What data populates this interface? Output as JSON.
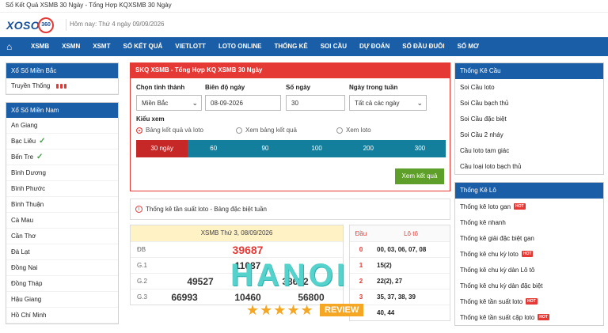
{
  "topbar": "Sổ Kết Quả XSMB 30 Ngày - Tổng Hợp KQXSMB 30 Ngày",
  "logo": {
    "brand": "XOSO",
    "number": "360"
  },
  "date_text": "Hôm nay: Thứ 4 ngày 09/09/2026",
  "nav": [
    "XSMB",
    "XSMN",
    "XSMT",
    "SỔ KẾT QUẢ",
    "VIETLOTT",
    "LOTO ONLINE",
    "THỐNG KÊ",
    "SOI CẦU",
    "DỰ ĐOÁN",
    "SỔ ĐẦU ĐUÔI",
    "SỔ MƠ"
  ],
  "left": {
    "north_title": "Xổ Số Miền Bắc",
    "north_item": "Truyền Thống",
    "south_title": "Xổ Số Miền Nam",
    "south_items": [
      "An Giang",
      "Bạc Liêu",
      "Bến Tre",
      "Bình Dương",
      "Bình Phước",
      "Bình Thuận",
      "Cà Mau",
      "Cần Thơ",
      "Đà Lạt",
      "Đồng Nai",
      "Đồng Tháp",
      "Hậu Giang",
      "Hồ Chí Minh"
    ]
  },
  "main": {
    "title": "SKQ XSMB - Tổng Hợp KQ XSMB 30 Ngày",
    "province_label": "Chọn tỉnh thành",
    "province": "Miền Bắc",
    "date_label": "Biên độ ngày",
    "date_value": "08-09-2026",
    "days_label": "Số ngày",
    "days_value": "30",
    "weekday_label": "Ngày trong tuần",
    "weekday_value": "Tất cả các ngày",
    "view_label": "Kiểu xem",
    "radios": [
      "Bảng kết quả và loto",
      "Xem bảng kết quả",
      "Xem loto"
    ],
    "tabs": [
      "30 ngày",
      "60",
      "90",
      "100",
      "200",
      "300"
    ],
    "submit": "Xem kết quả",
    "stat_text": "Thống kê tần suất loto - Bảng đặc biệt tuần",
    "result_header": "XSMB Thứ 3, 08/09/2026",
    "db_label": "ĐB",
    "db": "39687",
    "g1_label": "G.1",
    "g1": "11087",
    "g2_label": "G.2",
    "g2": [
      "49527",
      "38622"
    ],
    "g3_label": "G.3",
    "g3": [
      "66993",
      "10460",
      "56800"
    ],
    "loto_head": [
      "Đầu",
      "Lô tô"
    ],
    "loto_rows": [
      {
        "d": "0",
        "v": "00, 03, 06, 07, 08"
      },
      {
        "d": "1",
        "v": "15(2)"
      },
      {
        "d": "2",
        "v": "22(2), 27"
      },
      {
        "d": "3",
        "v": "35, 37, 38, 39"
      },
      {
        "d": "4",
        "v": "40, 44"
      }
    ]
  },
  "right": {
    "cau_title": "Thống Kê Cầu",
    "cau": [
      "Soi Cầu loto",
      "Soi Cầu bạch thủ",
      "Soi Cầu đặc biệt",
      "Soi Cầu 2 nháy",
      "Cầu loto tam giác",
      "Cầu loại loto bạch thủ"
    ],
    "lo_title": "Thống Kê Lô",
    "lo": [
      "Thống kê loto gan",
      "Thống kê nhanh",
      "Thống kê giải đặc biệt gan",
      "Thống kê chu kỳ loto",
      "Thống kê chu kỳ dàn Lô tô",
      "Thống kê chu kỳ dàn đặc biệt",
      "Thống kê tần suất loto",
      "Thống kê tần suất cặp loto"
    ],
    "hot": "HOT"
  },
  "watermark": {
    "word": "HANOI",
    "review": "REVIEW",
    "stars": "★★★★★"
  }
}
